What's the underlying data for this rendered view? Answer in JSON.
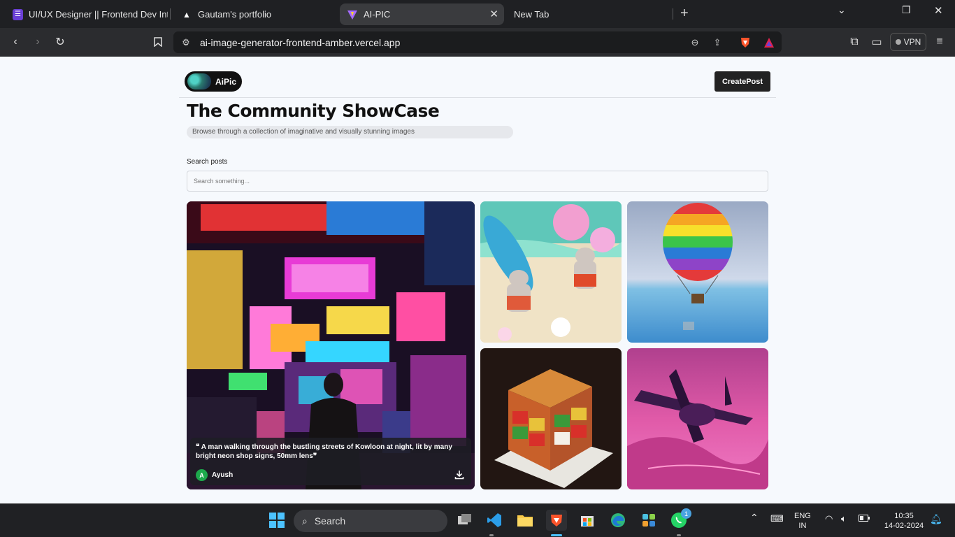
{
  "browser": {
    "tabs": [
      {
        "title": "UI/UX Designer || Frontend Dev Inter",
        "icon": "purple-list-icon"
      },
      {
        "title": "Gautam's portfolio",
        "icon": "triangle-icon"
      },
      {
        "title": "AI-PIC",
        "icon": "vite-icon",
        "active": true
      },
      {
        "title": "New Tab",
        "icon": ""
      }
    ],
    "url": "ai-image-generator-frontend-amber.vercel.app",
    "vpn_label": "VPN"
  },
  "app": {
    "logo_text": "AiPic",
    "create_label": "CreatePost",
    "title": "The Community ShowCase",
    "subtitle": "Browse through a collection of imaginative and visually stunning images",
    "search": {
      "label": "Search posts",
      "placeholder": "Search something...",
      "value": ""
    },
    "posts": [
      {
        "prompt": "A man walking through the bustling streets of Kowloon at night, lit by many bright neon shop signs, 50mm lens",
        "author": "Ayush",
        "author_initial": "A",
        "avatar_color": "#1da94c"
      }
    ]
  },
  "taskbar": {
    "search_label": "Search",
    "language": "ENG",
    "region": "IN",
    "time": "10:35",
    "date": "14-02-2024",
    "whatsapp_badge": "1"
  }
}
